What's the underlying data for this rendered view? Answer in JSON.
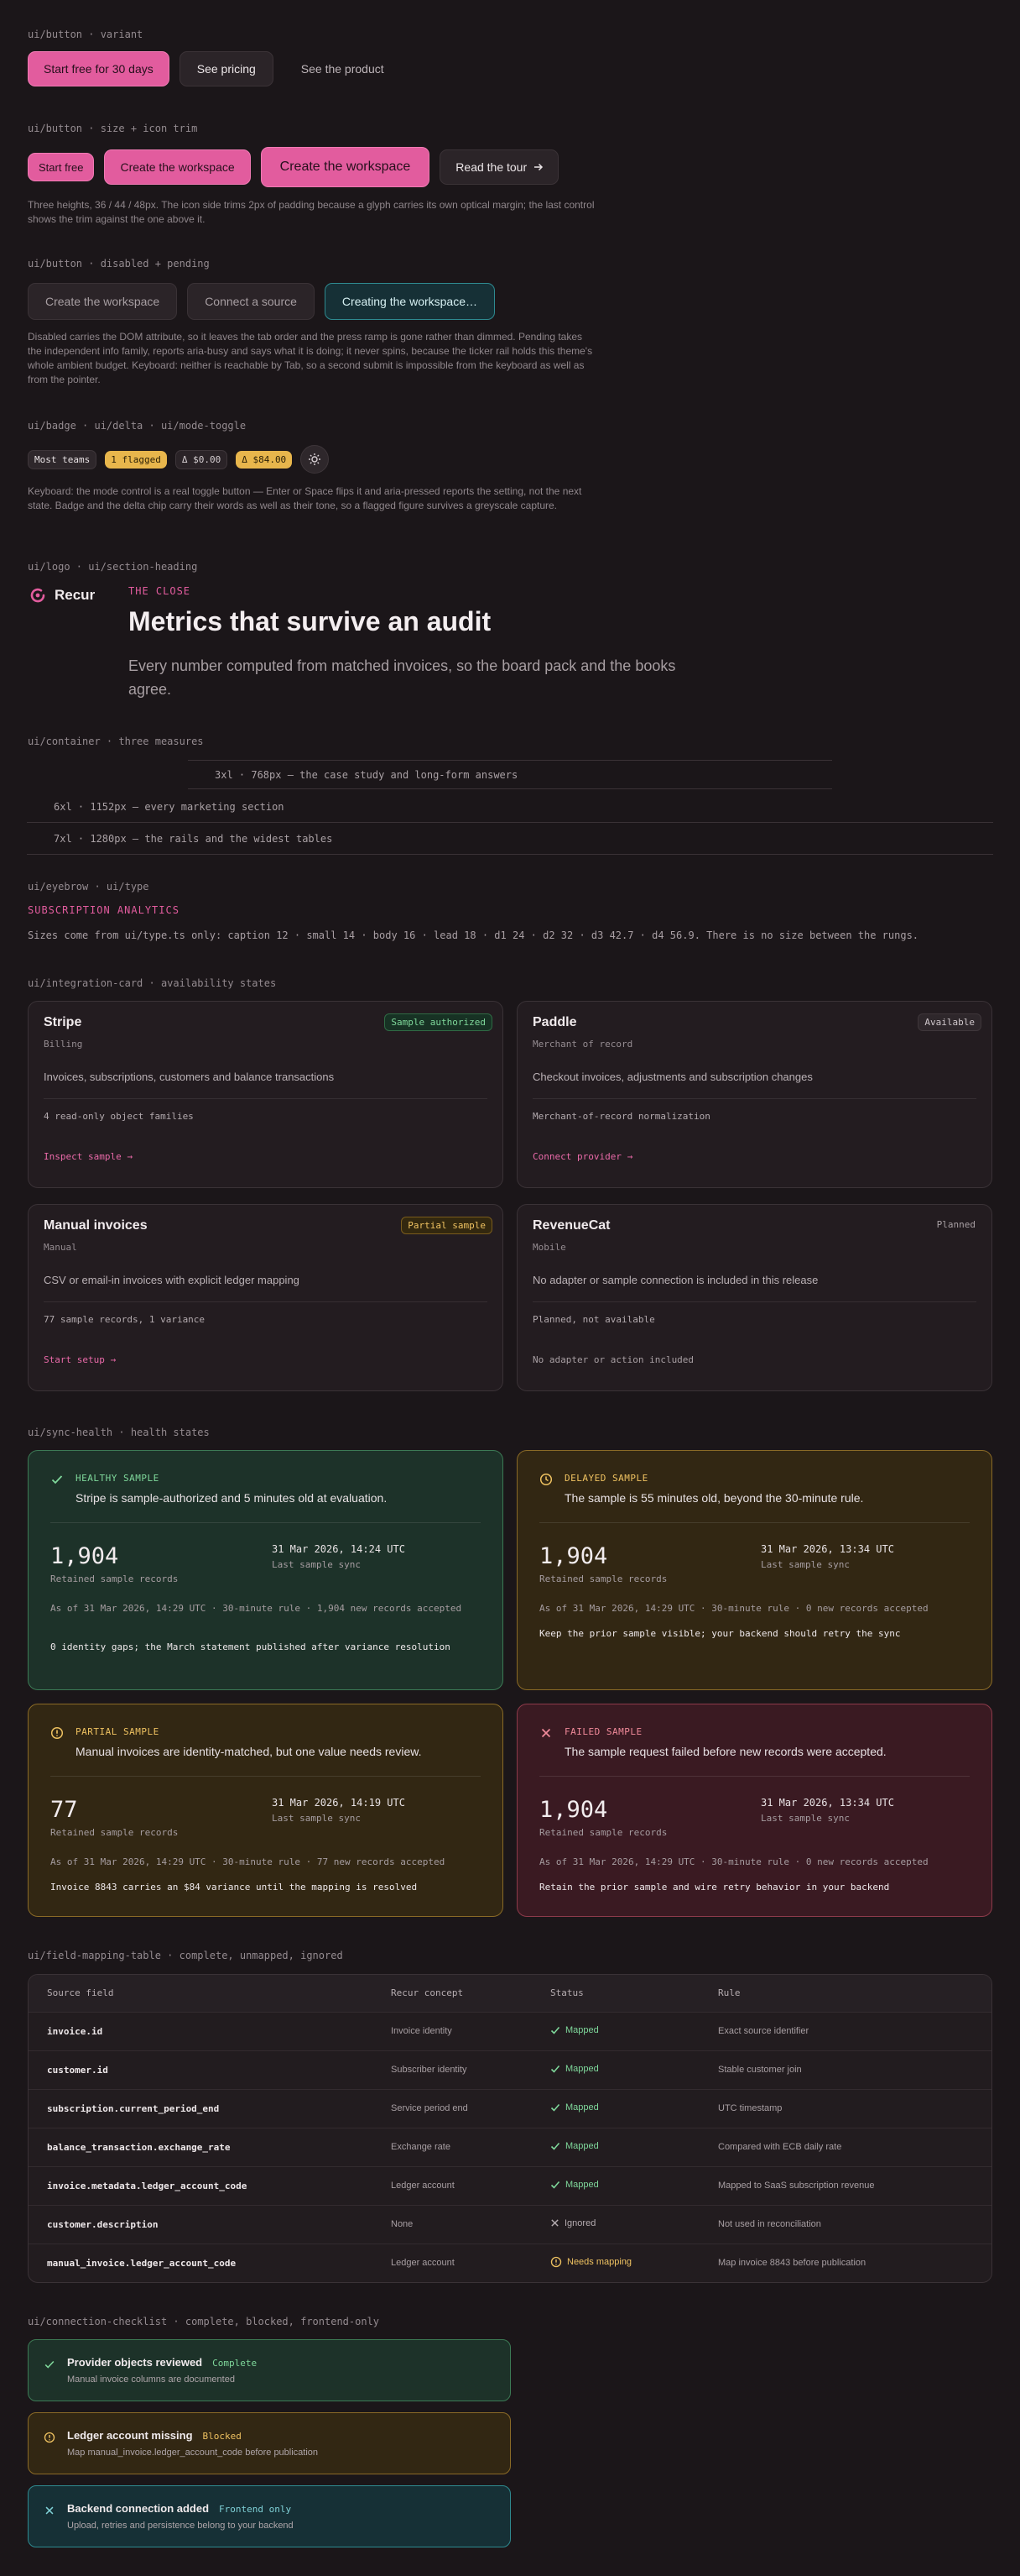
{
  "sections": {
    "button_variant": "ui/button · variant",
    "button_size": "ui/button · size + icon trim",
    "button_disabled": "ui/button · disabled + pending",
    "badge": "ui/badge · ui/delta · ui/mode-toggle",
    "logo": "ui/logo · ui/section-heading",
    "container": "ui/container · three measures",
    "eyebrow": "ui/eyebrow · ui/type",
    "integration": "ui/integration-card · availability states",
    "sync": "ui/sync-health · health states",
    "mapping": "ui/field-mapping-table · complete, unmapped, ignored",
    "checklist": "ui/connection-checklist · complete, blocked, frontend-only"
  },
  "variant_buttons": {
    "primary": "Start free for 30 days",
    "secondary": "See pricing",
    "ghost": "See the product"
  },
  "size_buttons": {
    "small": "Start free",
    "medium": "Create the workspace",
    "large": "Create the workspace",
    "icon": "Read the tour"
  },
  "size_note": "Three heights, 36 / 44 / 48px. The icon side trims 2px of padding because a glyph carries its own optical margin; the last control shows the trim against the one above it.",
  "disabled_buttons": {
    "disabled1": "Create the workspace",
    "disabled2": "Connect a source",
    "pending": "Creating the workspace…"
  },
  "disabled_note": "Disabled carries the DOM attribute, so it leaves the tab order and the press ramp is gone rather than dimmed. Pending takes the independent info family, reports aria-busy and says what it is doing; it never spins, because the ticker rail holds this theme's whole ambient budget. Keyboard: neither is reachable by Tab, so a second submit is impossible from the keyboard as well as from the pointer.",
  "badges": {
    "teams": "Most teams",
    "flagged": "1 flagged",
    "delta_zero": "Δ $0.00",
    "delta_pos": "Δ $84.00"
  },
  "badge_note": "Keyboard: the mode control is a real toggle button — Enter or Space flips it and aria-pressed reports the setting, not the next state. Badge and the delta chip carry their words as well as their tone, so a flagged figure survives a greyscale capture.",
  "logo": {
    "name": "Recur",
    "eyebrow": "THE CLOSE",
    "heading": "Metrics that survive an audit",
    "lead": "Every number computed from matched invoices, so the board pack and the books agree."
  },
  "containers": {
    "c3xl": "3xl · 768px — the case study and long-form answers",
    "c6xl": "6xl · 1152px — every marketing section",
    "c7xl": "7xl · 1280px — the rails and the widest tables"
  },
  "eyebrow": {
    "text": "SUBSCRIPTION ANALYTICS",
    "sizes": "Sizes come from ui/type.ts only: caption 12 · small 14 · body 16 · lead 18 · d1 24 · d2 32 · d3 42.7 · d4 56.9. There is no size between the rungs."
  },
  "integrations": [
    {
      "title": "Stripe",
      "sub": "Billing",
      "badge": "Sample authorized",
      "desc": "Invoices, subscriptions, customers and balance transactions",
      "meta": "4 read-only object families",
      "action": "Inspect sample →"
    },
    {
      "title": "Paddle",
      "sub": "Merchant of record",
      "badge": "Available",
      "desc": "Checkout invoices, adjustments and subscription changes",
      "meta": "Merchant-of-record normalization",
      "action": "Connect provider →"
    },
    {
      "title": "Manual invoices",
      "sub": "Manual",
      "badge": "Partial sample",
      "desc": "CSV or email-in invoices with explicit ledger mapping",
      "meta": "77 sample records, 1 variance",
      "action": "Start setup →"
    },
    {
      "title": "RevenueCat",
      "sub": "Mobile",
      "badge": "Planned",
      "desc": "No adapter or sample connection is included in this release",
      "meta": "Planned, not available",
      "action": "No adapter or action included"
    }
  ],
  "sync": [
    {
      "tag": "HEALTHY SAMPLE",
      "headline": "Stripe is sample-authorized and 5 minutes old at evaluation.",
      "count": "1,904",
      "count_label": "Retained sample records",
      "date": "31 Mar 2026, 14:24 UTC",
      "date_label": "Last sample sync",
      "asof": "As of 31 Mar 2026, 14:29 UTC · 30-minute rule · 1,904 new records accepted",
      "foot": "0 identity gaps; the March statement published after variance resolution"
    },
    {
      "tag": "DELAYED SAMPLE",
      "headline": "The sample is 55 minutes old, beyond the 30-minute rule.",
      "count": "1,904",
      "count_label": "Retained sample records",
      "date": "31 Mar 2026, 13:34 UTC",
      "date_label": "Last sample sync",
      "asof": "As of 31 Mar 2026, 14:29 UTC · 30-minute rule · 0 new records accepted",
      "foot": "Keep the prior sample visible; your backend should retry the sync"
    },
    {
      "tag": "PARTIAL SAMPLE",
      "headline": "Manual invoices are identity-matched, but one value needs review.",
      "count": "77",
      "count_label": "Retained sample records",
      "date": "31 Mar 2026, 14:19 UTC",
      "date_label": "Last sample sync",
      "asof": "As of 31 Mar 2026, 14:29 UTC · 30-minute rule · 77 new records accepted",
      "foot": "Invoice 8843 carries an $84 variance until the mapping is resolved"
    },
    {
      "tag": "FAILED SAMPLE",
      "headline": "The sample request failed before new records were accepted.",
      "count": "1,904",
      "count_label": "Retained sample records",
      "date": "31 Mar 2026, 13:34 UTC",
      "date_label": "Last sample sync",
      "asof": "As of 31 Mar 2026, 14:29 UTC · 30-minute rule · 0 new records accepted",
      "foot": "Retain the prior sample and wire retry behavior in your backend"
    }
  ],
  "mapping": {
    "headers": [
      "Source field",
      "Recur concept",
      "Status",
      "Rule"
    ],
    "rows": [
      {
        "field": "invoice.id",
        "concept": "Invoice identity",
        "status": "Mapped",
        "rule": "Exact source identifier"
      },
      {
        "field": "customer.id",
        "concept": "Subscriber identity",
        "status": "Mapped",
        "rule": "Stable customer join"
      },
      {
        "field": "subscription.current_period_end",
        "concept": "Service period end",
        "status": "Mapped",
        "rule": "UTC timestamp"
      },
      {
        "field": "balance_transaction.exchange_rate",
        "concept": "Exchange rate",
        "status": "Mapped",
        "rule": "Compared with ECB daily rate"
      },
      {
        "field": "invoice.metadata.ledger_account_code",
        "concept": "Ledger account",
        "status": "Mapped",
        "rule": "Mapped to SaaS subscription revenue"
      },
      {
        "field": "customer.description",
        "concept": "None",
        "status": "Ignored",
        "rule": "Not used in reconciliation"
      },
      {
        "field": "manual_invoice.ledger_account_code",
        "concept": "Ledger account",
        "status": "Needs mapping",
        "rule": "Map invoice 8843 before publication"
      }
    ]
  },
  "checklist": [
    {
      "title": "Provider objects reviewed",
      "badge": "Complete",
      "desc": "Manual invoice columns are documented"
    },
    {
      "title": "Ledger account missing",
      "badge": "Blocked",
      "desc": "Map manual_invoice.ledger_account_code before publication"
    },
    {
      "title": "Backend connection added",
      "badge": "Frontend only",
      "desc": "Upload, retries and persistence belong to your backend"
    }
  ],
  "colors": {
    "accent": "#e25c9e",
    "healthy": "#6fcf8d",
    "delayed": "#e8b64c",
    "failed": "#e87a8a",
    "info": "#4fb8c0"
  }
}
